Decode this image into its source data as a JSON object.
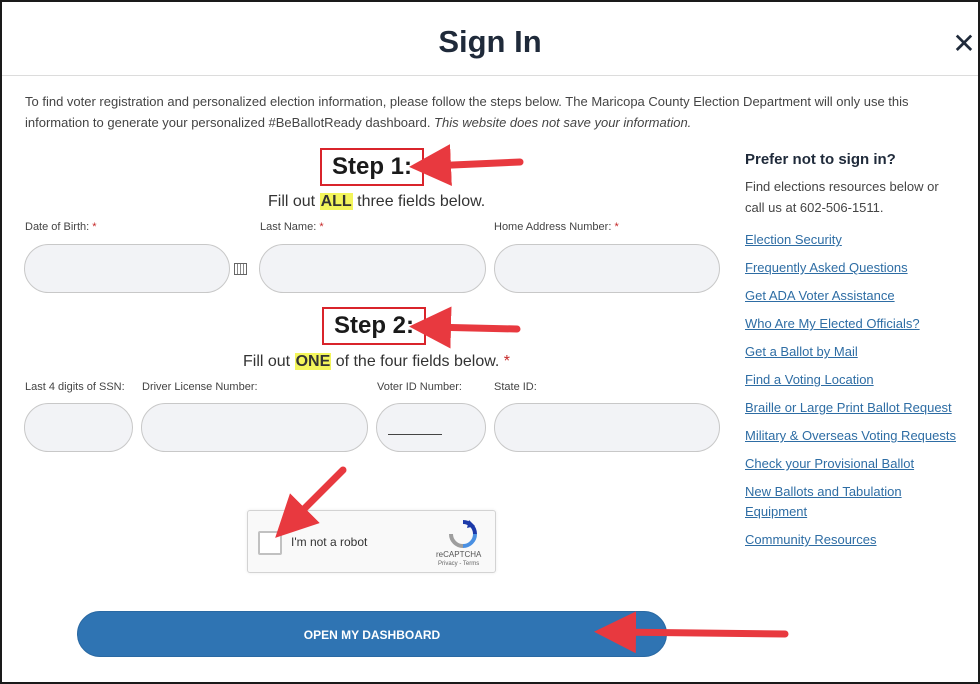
{
  "modal": {
    "title": "Sign In",
    "close_label": "✕"
  },
  "intro": {
    "text": "To find voter registration and personalized election information, please follow the steps below. The Maricopa County Election Department will only use this information to generate your personalized #BeBallotReady dashboard. ",
    "italic": "This website does not save your information."
  },
  "step1": {
    "title": "Step 1:",
    "pre": "Fill out ",
    "highlight": "ALL",
    "post": " three fields below.",
    "fields": [
      {
        "label": "Date of Birth:",
        "req": "*"
      },
      {
        "label": "Last Name:",
        "req": "*"
      },
      {
        "label": "Home Address Number:",
        "req": "*"
      }
    ]
  },
  "step2": {
    "title": "Step 2:",
    "pre": "Fill out ",
    "highlight": "ONE",
    "post": " of the four fields below. ",
    "req": "*",
    "fields": [
      {
        "label": "Last 4 digits of SSN:"
      },
      {
        "label": "Driver License Number:"
      },
      {
        "label": "Voter ID Number:"
      },
      {
        "label": "State ID:"
      }
    ]
  },
  "captcha": {
    "label": "I'm not a robot",
    "brand": "reCAPTCHA",
    "terms": "Privacy - Terms"
  },
  "submit_label": "OPEN MY DASHBOARD",
  "sidebar": {
    "heading": "Prefer not to sign in?",
    "text": "Find elections resources below or call us at 602-506-1511.",
    "links": [
      {
        "label": "Election Security"
      },
      {
        "label": "Frequently Asked Questions"
      },
      {
        "label": "Get ADA Voter Assistance"
      },
      {
        "label": "Who Are My Elected Officials?"
      },
      {
        "label": "Get a Ballot by Mail"
      },
      {
        "label": "Find a Voting Location"
      },
      {
        "label": "Braille or Large Print Ballot Request"
      },
      {
        "label": "Military & Overseas Voting Requests"
      },
      {
        "label": "Check your Provisional Ballot"
      },
      {
        "label": "New Ballots and Tabulation"
      },
      {
        "label": "Equipment"
      },
      {
        "label": "Community Resources"
      }
    ]
  },
  "colors": {
    "accent": "#2f74b3",
    "annotation_arrow": "#e8393f",
    "highlight": "#f3f55b"
  }
}
